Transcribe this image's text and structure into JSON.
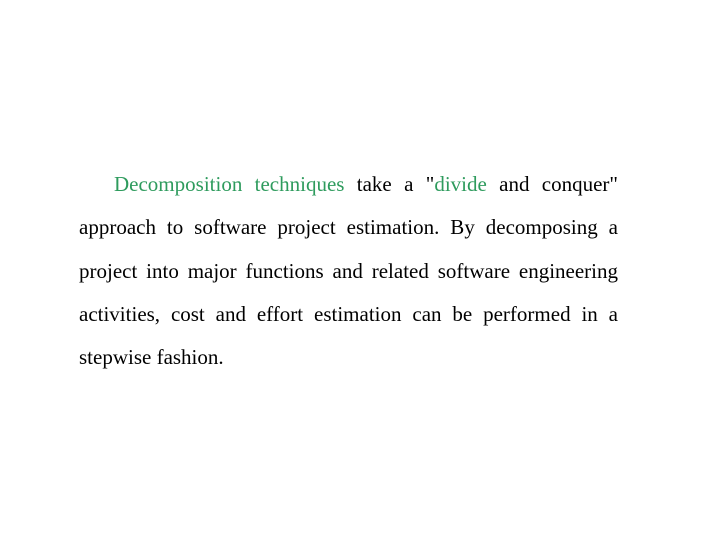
{
  "theme": {
    "accent_color": "#2e9b5d",
    "text_color": "#000000",
    "background_color": "#ffffff"
  },
  "paragraph": {
    "segments": [
      {
        "text": "Decomposition techniques",
        "highlight": true
      },
      {
        "text": " take a \"",
        "highlight": false
      },
      {
        "text": "divide",
        "highlight": true
      },
      {
        "text": " and conquer\" approach to software project estimation. By decomposing a project into major functions and related software engineering activities, cost and effort estimation can be performed in a stepwise fashion.",
        "highlight": false
      }
    ]
  }
}
